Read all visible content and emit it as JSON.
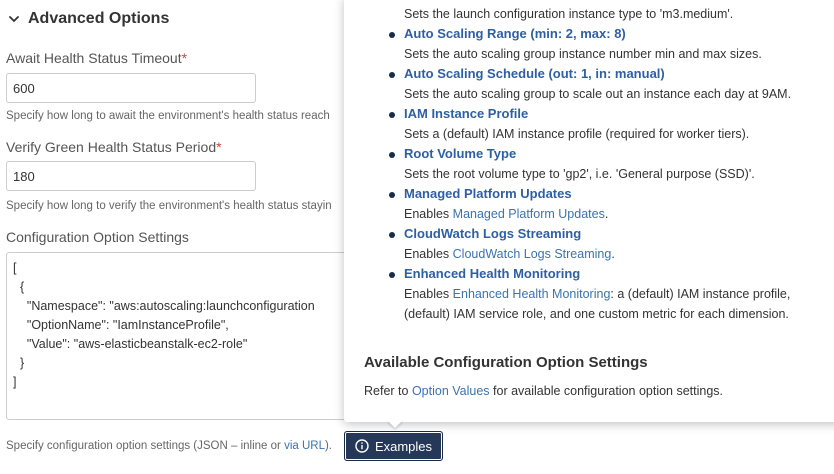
{
  "section": {
    "title": "Advanced Options"
  },
  "fields": {
    "await_health": {
      "label": "Await Health Status Timeout",
      "required_mark": "*",
      "value": "600",
      "help": "Specify how long to await the environment's health status reach"
    },
    "verify_green": {
      "label": "Verify Green Health Status Period",
      "required_mark": "*",
      "value": "180",
      "help": "Specify how long to verify the environment's health status stayin"
    },
    "config_settings": {
      "label": "Configuration Option Settings",
      "json_lines": [
        "[",
        "  {",
        "    \"Namespace\": \"aws:autoscaling:launchconfiguration",
        "    \"OptionName\": \"IamInstanceProfile\",",
        "    \"Value\": \"aws-elasticbeanstalk-ec2-role\"",
        "  }",
        "]"
      ],
      "help_prefix": "Specify configuration option settings (JSON – inline or ",
      "help_link": "via URL",
      "help_suffix": ")."
    }
  },
  "examples_button": {
    "label": "Examples"
  },
  "popup": {
    "top_desc": "Sets the launch configuration instance type to 'm3.medium'.",
    "features": [
      {
        "title": "Auto Scaling Range (min: 2, max: 8)",
        "desc": "Sets the auto scaling group instance number min and max sizes."
      },
      {
        "title": "Auto Scaling Schedule (out: 1, in: manual)",
        "desc": "Sets the auto scaling group to scale out an instance each day at 9AM."
      },
      {
        "title": "IAM Instance Profile",
        "desc": "Sets a (default) IAM instance profile (required for worker tiers)."
      },
      {
        "title": "Root Volume Type",
        "desc": "Sets the root volume type to 'gp2', i.e. 'General purpose (SSD)'."
      },
      {
        "title": "Managed Platform Updates",
        "desc_prefix": "Enables ",
        "desc_link": "Managed Platform Updates",
        "desc_suffix": "."
      },
      {
        "title": "CloudWatch Logs Streaming",
        "desc_prefix": "Enables ",
        "desc_link": "CloudWatch Logs Streaming",
        "desc_suffix": "."
      },
      {
        "title": "Enhanced Health Monitoring",
        "desc_prefix": "Enables ",
        "desc_link": "Enhanced Health Monitoring",
        "desc_suffix": ": a (default) IAM instance profile,",
        "desc_line2": "(default) IAM service role, and one custom metric for each dimension."
      }
    ],
    "available_title": "Available Configuration Option Settings",
    "available_prefix": "Refer to ",
    "available_link": "Option Values",
    "available_suffix": " for available configuration option settings."
  },
  "colors": {
    "link": "#3b73af",
    "feature_title": "#2f5fa3",
    "button_bg": "#253858",
    "required": "#d04437"
  },
  "icons": {
    "section_toggle": "chevron-down-icon",
    "examples": "info-circle-icon"
  }
}
